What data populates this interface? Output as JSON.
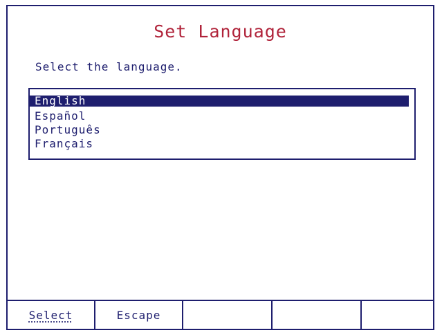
{
  "screen": {
    "title": "Set Language",
    "prompt": "Select the language."
  },
  "languages": {
    "items": [
      {
        "label": "English",
        "selected": true
      },
      {
        "label": "Español",
        "selected": false
      },
      {
        "label": "Português",
        "selected": false
      },
      {
        "label": "Français",
        "selected": false
      }
    ]
  },
  "softkeys": {
    "items": [
      {
        "label": "Select",
        "focused": true
      },
      {
        "label": "Escape",
        "focused": false
      },
      {
        "label": ""
      },
      {
        "label": ""
      },
      {
        "label": ""
      }
    ]
  },
  "colors": {
    "title": "#b0233a",
    "text": "#1e1e6e",
    "selection_bg": "#1e1e6e",
    "background": "#ffffff"
  }
}
